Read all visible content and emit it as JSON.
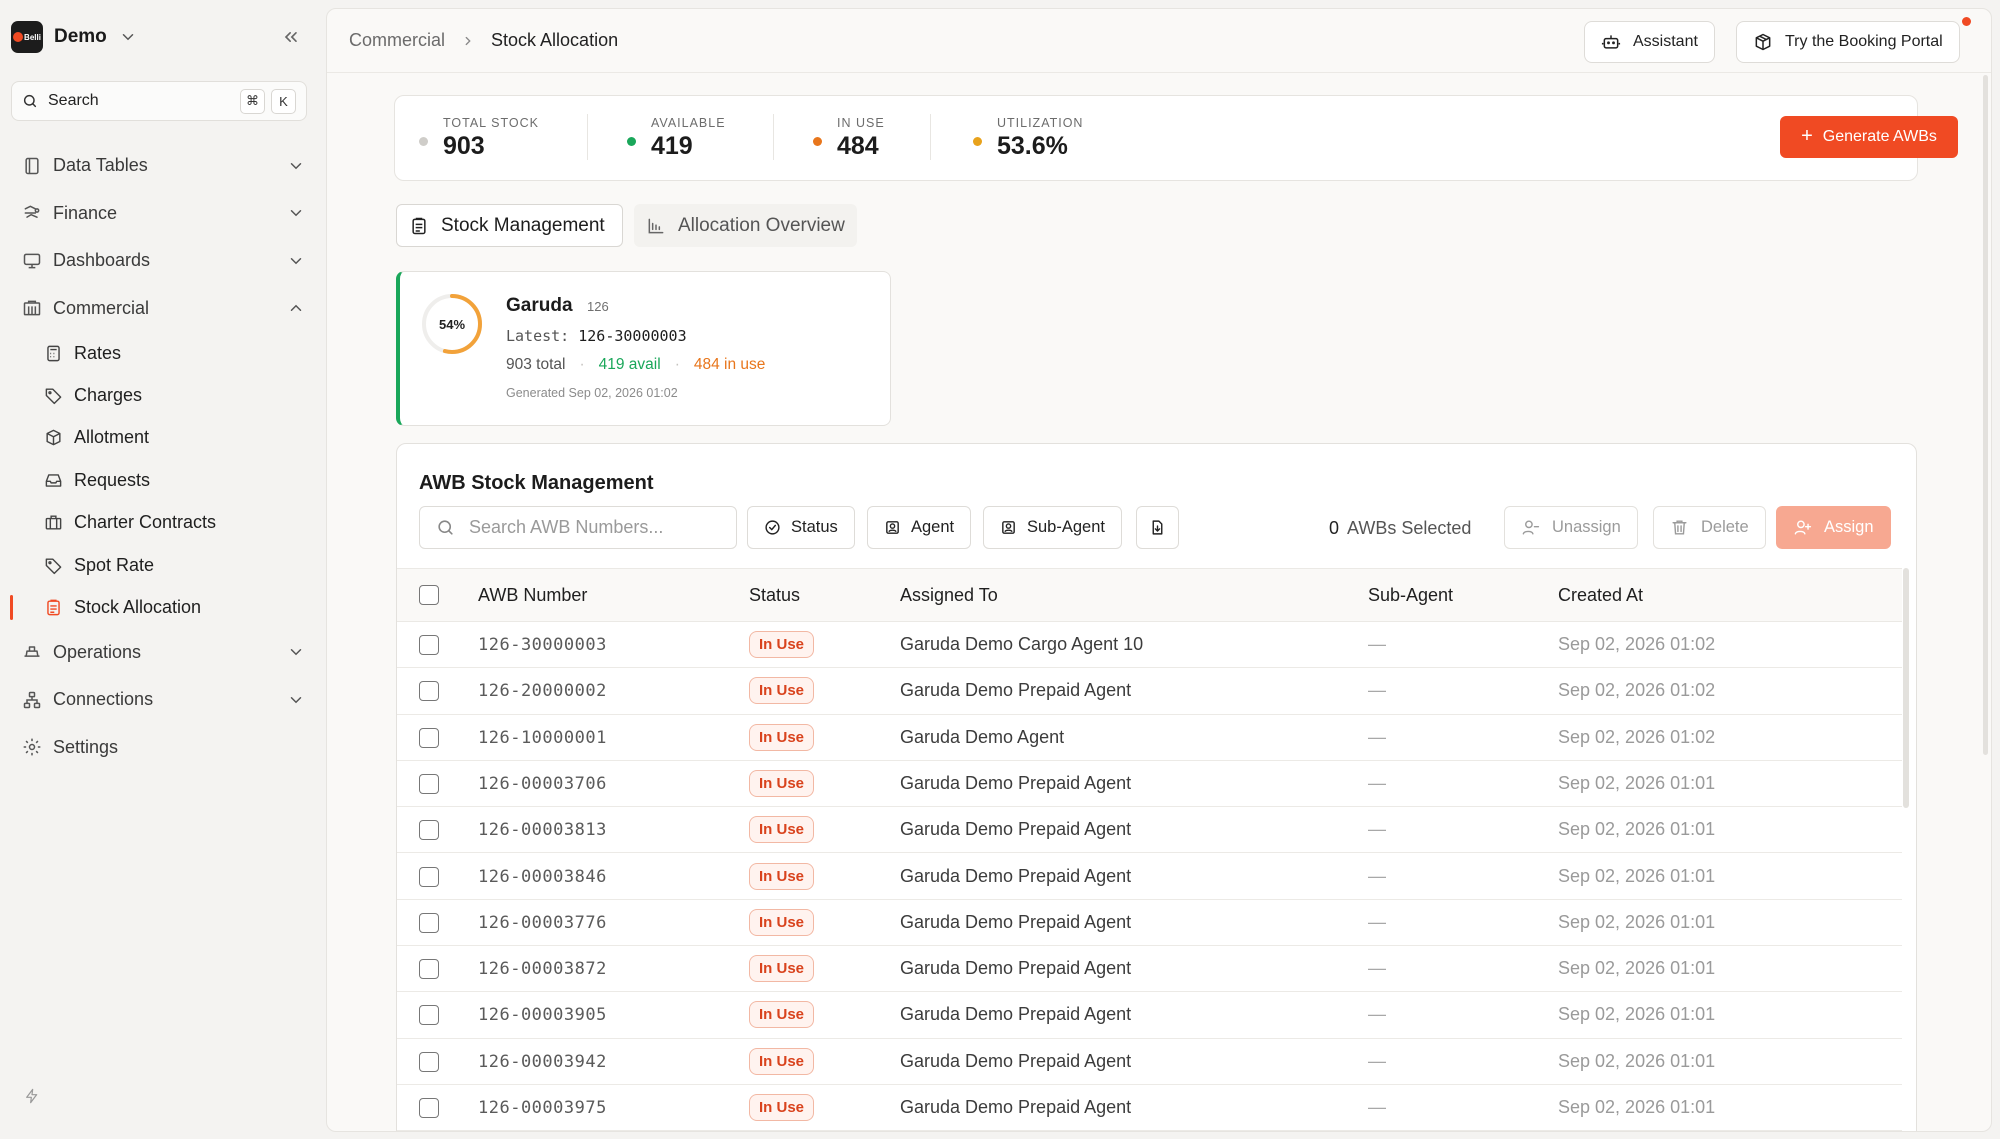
{
  "sidebar": {
    "brand_name": "Demo",
    "logo_text": "Belli",
    "search_label": "Search",
    "search_kbd": [
      "⌘",
      "K"
    ],
    "nav": [
      {
        "label": "Data Tables"
      },
      {
        "label": "Finance"
      },
      {
        "label": "Dashboards"
      },
      {
        "label": "Commercial"
      }
    ],
    "commercial_items": [
      {
        "label": "Rates"
      },
      {
        "label": "Charges"
      },
      {
        "label": "Allotment"
      },
      {
        "label": "Requests"
      },
      {
        "label": "Charter Contracts"
      },
      {
        "label": "Spot Rate"
      },
      {
        "label": "Stock Allocation"
      }
    ],
    "nav_bottom": [
      {
        "label": "Operations"
      },
      {
        "label": "Connections"
      },
      {
        "label": "Settings"
      }
    ]
  },
  "header": {
    "breadcrumb": [
      "Commercial",
      "Stock Allocation"
    ],
    "assistant_label": "Assistant",
    "portal_label": "Try the Booking Portal"
  },
  "stats": {
    "total": {
      "label": "TOTAL STOCK",
      "value": "903"
    },
    "available": {
      "label": "AVAILABLE",
      "value": "419"
    },
    "in_use": {
      "label": "IN USE",
      "value": "484"
    },
    "utilization": {
      "label": "UTILIZATION",
      "value": "53.6%"
    },
    "generate_label": "Generate AWBs"
  },
  "tabs": [
    {
      "label": "Stock Management"
    },
    {
      "label": "Allocation Overview"
    }
  ],
  "airline_card": {
    "pct_label": "54%",
    "pct": 0.54,
    "name": "Garuda",
    "code": "126",
    "latest_label": "Latest:",
    "latest_value": "126-30000003",
    "total_text": "903 total",
    "avail_text": "419 avail",
    "in_use_text": "484 in use",
    "generated": "Generated Sep 02, 2026 01:02"
  },
  "table": {
    "title": "AWB Stock Management",
    "search_placeholder": "Search AWB Numbers...",
    "filters": {
      "status": "Status",
      "agent": "Agent",
      "sub_agent": "Sub-Agent"
    },
    "selected_count": "0",
    "selected_label": "AWBs Selected",
    "actions": {
      "unassign": "Unassign",
      "delete": "Delete",
      "assign": "Assign"
    },
    "columns": [
      "AWB Number",
      "Status",
      "Assigned To",
      "Sub-Agent",
      "Created At"
    ],
    "rows": [
      {
        "awb": "126-30000003",
        "status": "In Use",
        "assigned": "Garuda Demo Cargo Agent 10",
        "sub": "—",
        "created": "Sep 02, 2026 01:02"
      },
      {
        "awb": "126-20000002",
        "status": "In Use",
        "assigned": "Garuda Demo Prepaid Agent",
        "sub": "—",
        "created": "Sep 02, 2026 01:02"
      },
      {
        "awb": "126-10000001",
        "status": "In Use",
        "assigned": "Garuda Demo Agent",
        "sub": "—",
        "created": "Sep 02, 2026 01:02"
      },
      {
        "awb": "126-00003706",
        "status": "In Use",
        "assigned": "Garuda Demo Prepaid Agent",
        "sub": "—",
        "created": "Sep 02, 2026 01:01"
      },
      {
        "awb": "126-00003813",
        "status": "In Use",
        "assigned": "Garuda Demo Prepaid Agent",
        "sub": "—",
        "created": "Sep 02, 2026 01:01"
      },
      {
        "awb": "126-00003846",
        "status": "In Use",
        "assigned": "Garuda Demo Prepaid Agent",
        "sub": "—",
        "created": "Sep 02, 2026 01:01"
      },
      {
        "awb": "126-00003776",
        "status": "In Use",
        "assigned": "Garuda Demo Prepaid Agent",
        "sub": "—",
        "created": "Sep 02, 2026 01:01"
      },
      {
        "awb": "126-00003872",
        "status": "In Use",
        "assigned": "Garuda Demo Prepaid Agent",
        "sub": "—",
        "created": "Sep 02, 2026 01:01"
      },
      {
        "awb": "126-00003905",
        "status": "In Use",
        "assigned": "Garuda Demo Prepaid Agent",
        "sub": "—",
        "created": "Sep 02, 2026 01:01"
      },
      {
        "awb": "126-00003942",
        "status": "In Use",
        "assigned": "Garuda Demo Prepaid Agent",
        "sub": "—",
        "created": "Sep 02, 2026 01:01"
      },
      {
        "awb": "126-00003975",
        "status": "In Use",
        "assigned": "Garuda Demo Prepaid Agent",
        "sub": "—",
        "created": "Sep 02, 2026 01:01"
      }
    ]
  },
  "colors": {
    "accent": "#f04a23",
    "available": "#1aa75a",
    "in_use": "#e8761c",
    "total": "#cfcdc9"
  }
}
